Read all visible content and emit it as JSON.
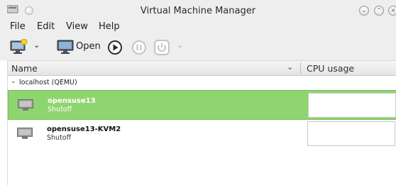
{
  "window": {
    "title": "Virtual Machine Manager"
  },
  "menubar": {
    "items": [
      {
        "label": "File"
      },
      {
        "label": "Edit"
      },
      {
        "label": "View"
      },
      {
        "label": "Help"
      }
    ]
  },
  "toolbar": {
    "new_vm_icon": "new-vm-icon",
    "open_label": "Open",
    "run_icon": "play-icon",
    "pause_icon": "pause-icon",
    "shutdown_icon": "power-icon"
  },
  "list": {
    "columns": [
      {
        "label": "Name"
      },
      {
        "label": "CPU usage"
      }
    ],
    "connection": "localhost (QEMU)",
    "vms": [
      {
        "name": "opensuse13",
        "state": "Shutoff",
        "selected": true
      },
      {
        "name": "opensuse13-KVM2",
        "state": "Shutoff",
        "selected": false
      }
    ]
  },
  "colors": {
    "selection": "#8fd56f",
    "chrome": "#eeeeee"
  }
}
